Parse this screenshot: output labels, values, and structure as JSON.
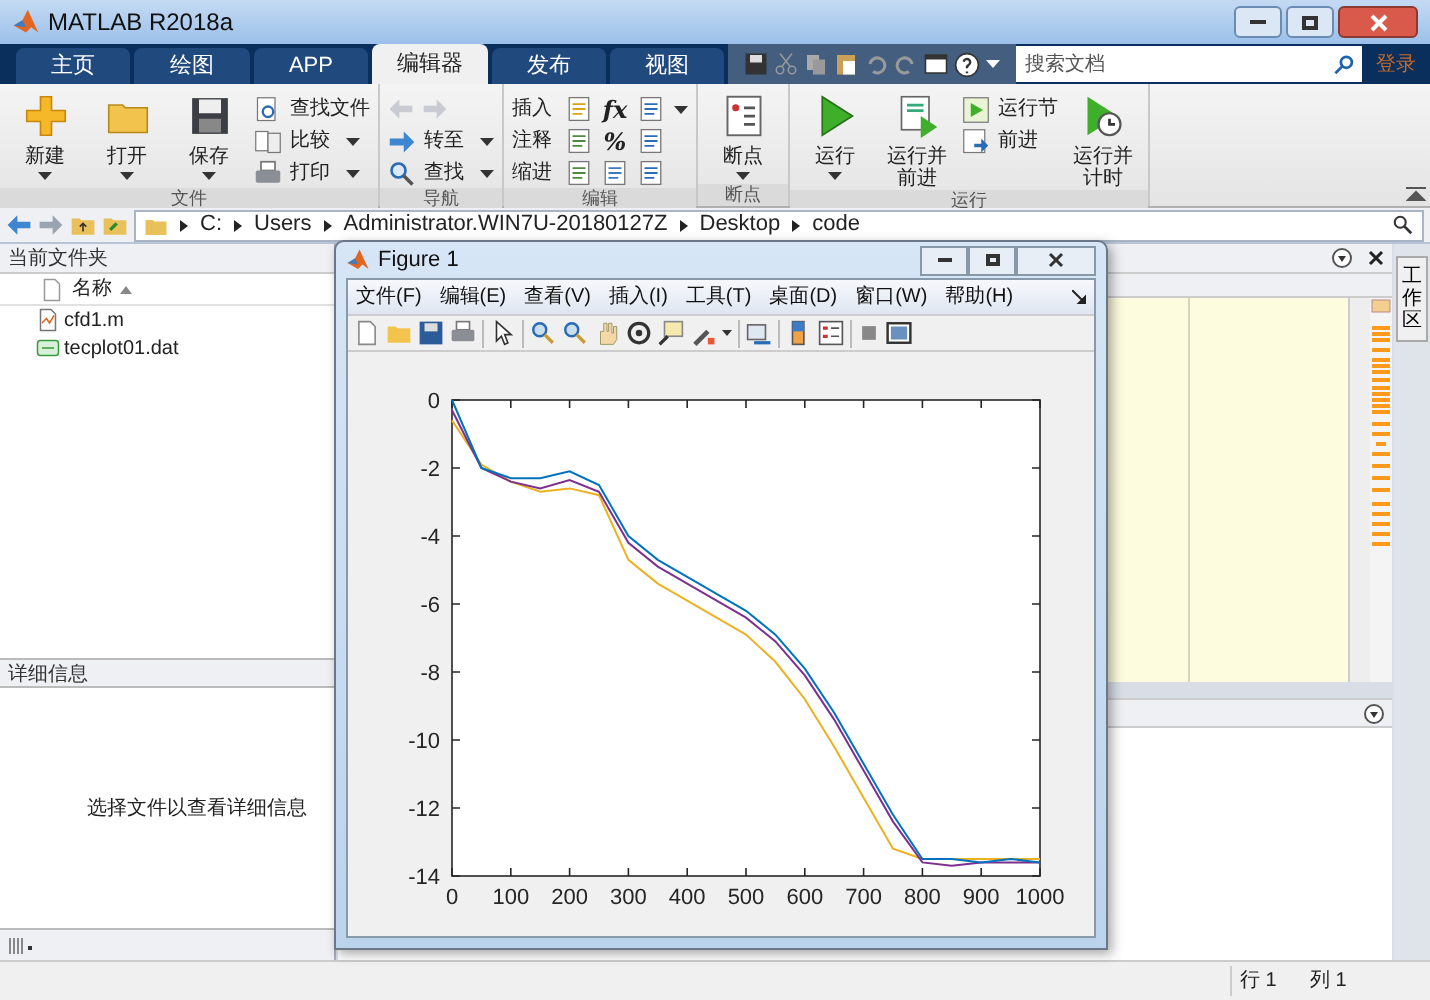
{
  "window": {
    "title": "MATLAB R2018a"
  },
  "tabs": [
    {
      "label": "主页",
      "selected": false
    },
    {
      "label": "绘图",
      "selected": false
    },
    {
      "label": "APP",
      "selected": false
    },
    {
      "label": "编辑器",
      "selected": true
    },
    {
      "label": "发布",
      "selected": false
    },
    {
      "label": "视图",
      "selected": false
    }
  ],
  "search": {
    "placeholder": "搜索文档"
  },
  "sign_in": "登录",
  "ribbon": {
    "groups": [
      {
        "title": "文件",
        "items": [
          {
            "kind": "large",
            "label": "新建",
            "dropdown": true
          },
          {
            "kind": "large",
            "label": "打开",
            "dropdown": true
          },
          {
            "kind": "large",
            "label": "保存",
            "dropdown": true
          },
          {
            "kind": "stack",
            "rows": [
              {
                "label": "查找文件",
                "dropdown": false
              },
              {
                "label": "比较",
                "dropdown": true
              },
              {
                "label": "打印",
                "dropdown": true
              }
            ]
          }
        ]
      },
      {
        "title": "导航",
        "items": [
          {
            "kind": "stack",
            "rows": [
              {
                "kind": "arrows",
                "disabled": true
              },
              {
                "label": "转至",
                "dropdown": true
              },
              {
                "label": "查找",
                "dropdown": true
              }
            ]
          }
        ]
      },
      {
        "title": "编辑",
        "items": [
          {
            "kind": "edit",
            "rows": [
              {
                "label": "插入",
                "glyph": "fx",
                "dropdown": true
              },
              {
                "label": "注释",
                "glyph": "%",
                "dropdown": false
              },
              {
                "label": "缩进",
                "dropdown": false
              }
            ]
          }
        ]
      },
      {
        "title": "断点",
        "items": [
          {
            "kind": "large",
            "label": "断点",
            "dropdown": true
          }
        ]
      },
      {
        "title": "运行",
        "items": [
          {
            "kind": "large",
            "label": "运行",
            "dropdown": true
          },
          {
            "kind": "large",
            "label": "运行并前进",
            "dropdown": false
          },
          {
            "kind": "stack",
            "rows": [
              {
                "label": "运行节",
                "dropdown": false
              },
              {
                "label": "前进",
                "dropdown": false
              }
            ]
          },
          {
            "kind": "large",
            "label": "运行并计时",
            "dropdown": false
          }
        ]
      }
    ]
  },
  "path": [
    "C:",
    "Users",
    "Administrator.WIN7U-20180127Z",
    "Desktop",
    "code"
  ],
  "current_folder": {
    "title": "当前文件夹",
    "column": "名称",
    "files": [
      {
        "name": "cfd1.m",
        "kind": "m"
      },
      {
        "name": "tecplot01.dat",
        "kind": "dat"
      }
    ]
  },
  "details": {
    "title": "详细信息",
    "message": "选择文件以查看详细信息"
  },
  "workspace_tab": "工作区",
  "figure": {
    "title": "Figure 1",
    "menu": [
      "文件(F)",
      "编辑(E)",
      "查看(V)",
      "插入(I)",
      "工具(T)",
      "桌面(D)",
      "窗口(W)",
      "帮助(H)"
    ],
    "chart_data": {
      "type": "line",
      "x": [
        0,
        50,
        100,
        150,
        200,
        250,
        300,
        350,
        400,
        450,
        500,
        550,
        600,
        650,
        700,
        750,
        800,
        850,
        900,
        950,
        1000
      ],
      "series": [
        {
          "color": "#0072bd",
          "values": [
            0,
            -2.0,
            -2.3,
            -2.3,
            -2.1,
            -2.5,
            -4.0,
            -4.7,
            -5.2,
            -5.7,
            -6.2,
            -6.9,
            -7.9,
            -9.2,
            -10.7,
            -12.2,
            -13.5,
            -13.5,
            -13.6,
            -13.5,
            -13.6
          ]
        },
        {
          "color": "#7e2f8e",
          "values": [
            -0.3,
            -2.0,
            -2.4,
            -2.6,
            -2.35,
            -2.7,
            -4.2,
            -4.9,
            -5.4,
            -5.9,
            -6.4,
            -7.1,
            -8.1,
            -9.4,
            -10.9,
            -12.4,
            -13.6,
            -13.7,
            -13.6,
            -13.6,
            -13.6
          ]
        },
        {
          "color": "#edb120",
          "values": [
            -0.6,
            -1.9,
            -2.4,
            -2.7,
            -2.6,
            -2.8,
            -4.7,
            -5.4,
            -5.9,
            -6.4,
            -6.9,
            -7.7,
            -8.8,
            -10.2,
            -11.7,
            -13.2,
            -13.5,
            -13.5,
            -13.5,
            -13.5,
            -13.5
          ]
        }
      ],
      "xlim": [
        0,
        1000
      ],
      "ylim": [
        -14,
        0
      ],
      "xticks": [
        0,
        100,
        200,
        300,
        400,
        500,
        600,
        700,
        800,
        900,
        1000
      ],
      "yticks": [
        0,
        -2,
        -4,
        -6,
        -8,
        -10,
        -12,
        -14
      ]
    }
  },
  "status_bar": {
    "row": "行 1",
    "column": "列 1"
  }
}
